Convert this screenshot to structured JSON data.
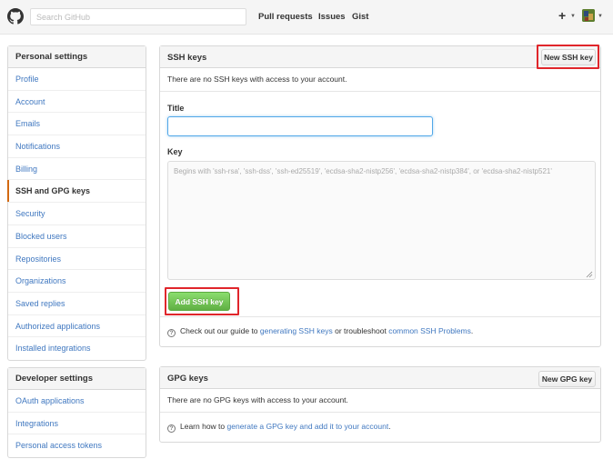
{
  "header": {
    "search_placeholder": "Search GitHub",
    "nav": [
      "Pull requests",
      "Issues",
      "Gist"
    ],
    "plus": "+",
    "caret": "▼"
  },
  "personal_menu": {
    "heading": "Personal settings",
    "items": [
      "Profile",
      "Account",
      "Emails",
      "Notifications",
      "Billing",
      "SSH and GPG keys",
      "Security",
      "Blocked users",
      "Repositories",
      "Organizations",
      "Saved replies",
      "Authorized applications",
      "Installed integrations"
    ],
    "selected": "SSH and GPG keys"
  },
  "developer_menu": {
    "heading": "Developer settings",
    "items": [
      "OAuth applications",
      "Integrations",
      "Personal access tokens"
    ]
  },
  "ssh": {
    "title": "SSH keys",
    "new_button": "New SSH key",
    "empty_text": "There are no SSH keys with access to your account.",
    "title_label": "Title",
    "title_value": "",
    "key_label": "Key",
    "key_placeholder": "Begins with 'ssh-rsa', 'ssh-dss', 'ssh-ed25519', 'ecdsa-sha2-nistp256', 'ecdsa-sha2-nistp384', or 'ecdsa-sha2-nistp521'",
    "add_button": "Add SSH key",
    "help_prefix": "Check out our guide to ",
    "help_link1": "generating SSH keys",
    "help_middle": " or troubleshoot ",
    "help_link2": "common SSH Problems",
    "help_suffix": "."
  },
  "gpg": {
    "title": "GPG keys",
    "new_button": "New GPG key",
    "empty_text": "There are no GPG keys with access to your account.",
    "help_prefix": "Learn how to ",
    "help_link": "generate a GPG key and add it to your account",
    "help_suffix": "."
  },
  "colors": {
    "link": "#4078c0",
    "highlight": "#e0262b",
    "primary_button": "#60b044",
    "selected_accent": "#d26911"
  }
}
